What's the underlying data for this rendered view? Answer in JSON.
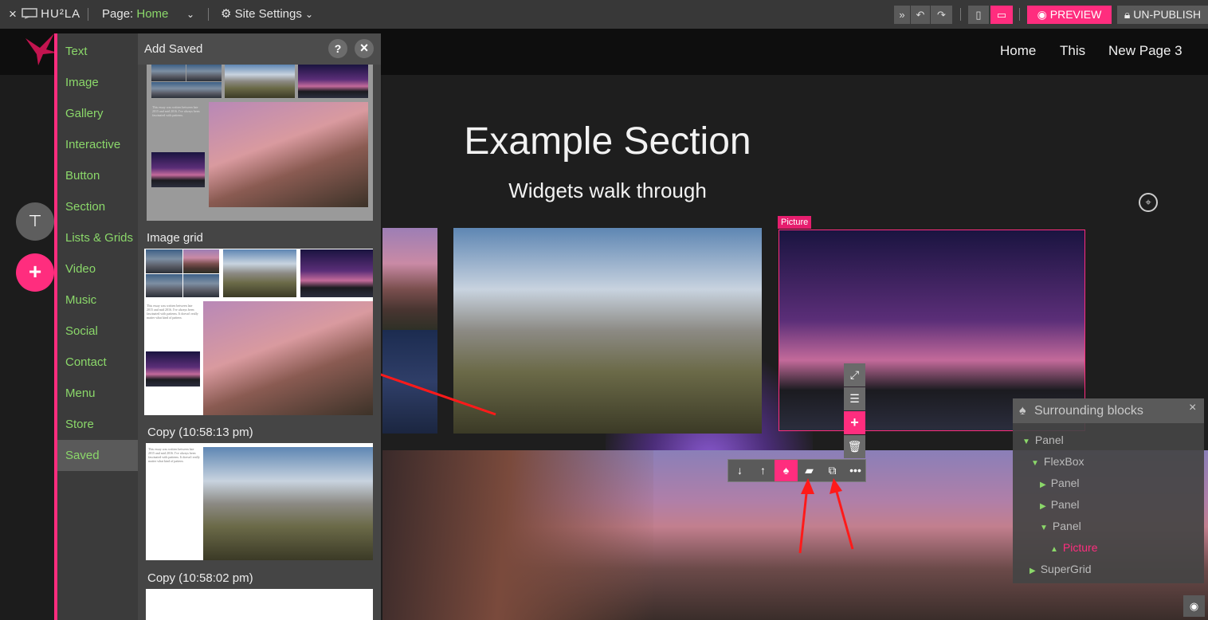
{
  "topbar": {
    "close_glyph": "×",
    "logo": "HU²LA",
    "page_label": "Page:",
    "page_name": "Home",
    "settings_label": "Site Settings",
    "preview_label": "PREVIEW",
    "unpublish_label": "UN-PUBLISH"
  },
  "site_nav": [
    "Home",
    "This",
    "New Page 3"
  ],
  "widgets": [
    {
      "label": "Text"
    },
    {
      "label": "Image"
    },
    {
      "label": "Gallery"
    },
    {
      "label": "Interactive"
    },
    {
      "label": "Button"
    },
    {
      "label": "Section"
    },
    {
      "label": "Lists & Grids"
    },
    {
      "label": "Video"
    },
    {
      "label": "Music"
    },
    {
      "label": "Social"
    },
    {
      "label": "Contact"
    },
    {
      "label": "Menu"
    },
    {
      "label": "Store"
    },
    {
      "label": "Saved"
    }
  ],
  "saved_panel": {
    "title": "Add Saved",
    "help_glyph": "?",
    "close_glyph": "×",
    "items": [
      {
        "label": "Image grid"
      },
      {
        "label": "Copy (10:58:13 pm)"
      },
      {
        "label": "Copy (10:58:02 pm)"
      }
    ]
  },
  "canvas": {
    "heading": "Example Section",
    "subheading": "Widgets walk through",
    "selected_tag": "Picture"
  },
  "surrounding_blocks": {
    "title": "Surrounding blocks",
    "close_glyph": "×",
    "tree": [
      {
        "label": "Panel"
      },
      {
        "label": "FlexBox"
      },
      {
        "label": "Panel"
      },
      {
        "label": "Panel"
      },
      {
        "label": "Panel"
      },
      {
        "label": "Picture"
      },
      {
        "label": "SuperGrid"
      }
    ]
  },
  "colors": {
    "accent": "#ff2d7e",
    "widget_text": "#8bd86a",
    "toolbar_bg": "#383838"
  }
}
